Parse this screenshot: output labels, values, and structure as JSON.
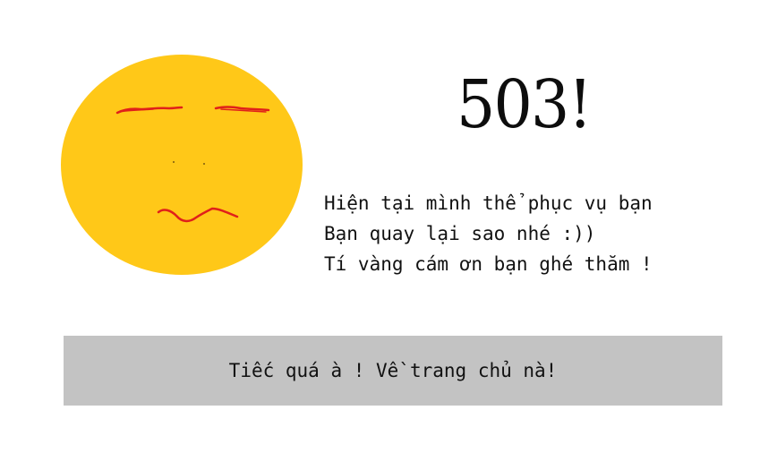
{
  "page": {
    "error_code": "503!",
    "message_lines": [
      "Hiện tại mình thể phục vụ bạn",
      "Bạn quay lại sao nhé :))",
      "Tí vàng cám ơn bạn ghé thăm !"
    ],
    "home_button_label": "Tiếc quá à ! Về trang chủ nà!"
  },
  "face_illustration": {
    "icon": "sleepy-face-icon",
    "face_color": "#ffc818",
    "feature_color": "#e0201a"
  }
}
